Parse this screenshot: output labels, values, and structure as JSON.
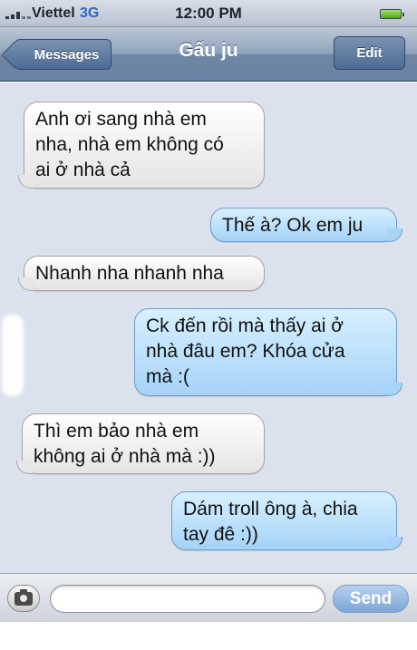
{
  "status_bar": {
    "carrier": "Viettel",
    "network": "3G",
    "time": "12:00 PM"
  },
  "nav": {
    "back_label": "Messages",
    "title": "Gấu ju",
    "edit_label": "Edit"
  },
  "messages": [
    {
      "direction": "incoming",
      "text": "Anh ơi sang nhà em\nnha, nhà em không có\nai ở nhà cả"
    },
    {
      "direction": "outgoing",
      "text": "Thế à? Ok em ju"
    },
    {
      "direction": "incoming",
      "text": "Nhanh nha nhanh nha"
    },
    {
      "direction": "outgoing",
      "text": "Ck đến rồi mà thấy ai ở\nnhà đâu em? Khóa cửa\nmà :("
    },
    {
      "direction": "incoming",
      "text": "Thì em bảo nhà em\nkhông ai ở nhà mà :))"
    },
    {
      "direction": "outgoing",
      "text": "Dám troll ông à, chia\ntay đê :))"
    }
  ],
  "composer": {
    "input_value": "",
    "input_placeholder": "",
    "send_label": "Send"
  },
  "icons": {
    "camera": "camera-icon",
    "signal": "signal-icon",
    "battery": "battery-icon"
  },
  "colors": {
    "outgoing_bubble": "#a6d3f8",
    "incoming_bubble": "#e4e4e4",
    "background": "#dbe2ed",
    "nav_bar": "#6f86a4"
  }
}
